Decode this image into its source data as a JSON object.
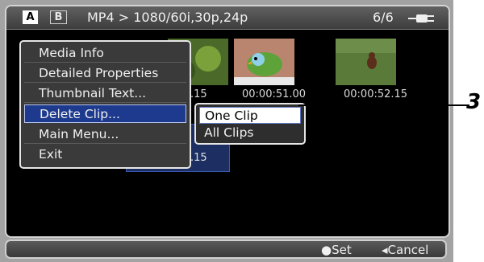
{
  "header": {
    "slot_a": "A",
    "slot_b": "B",
    "title": "MP4 > 1080/60i,30p,24p",
    "count": "6/6",
    "power_icon": "ac-plug-icon"
  },
  "thumbnails": [
    {
      "timecode": ".15"
    },
    {
      "timecode": "00:00:51.00"
    },
    {
      "timecode": "00:00:52.15"
    }
  ],
  "selected_thumbnail": {
    "timecode": ".15"
  },
  "menu": {
    "items": [
      {
        "label": "Media Info"
      },
      {
        "label": "Detailed Properties"
      },
      {
        "label": "Thumbnail Text..."
      },
      {
        "label": "Delete Clip...",
        "active": true
      },
      {
        "label": "Main Menu..."
      },
      {
        "label": "Exit"
      }
    ]
  },
  "submenu": {
    "items": [
      {
        "label": "One Clip",
        "highlight": true
      },
      {
        "label": "All Clips"
      }
    ]
  },
  "footer": {
    "set_label": "●Set",
    "cancel_label": "◂Cancel"
  },
  "callout": {
    "number": "3"
  },
  "colors": {
    "menu_active": "#1d3a8e",
    "screen_bezel": "#a3a3a3",
    "background": "#000000"
  }
}
